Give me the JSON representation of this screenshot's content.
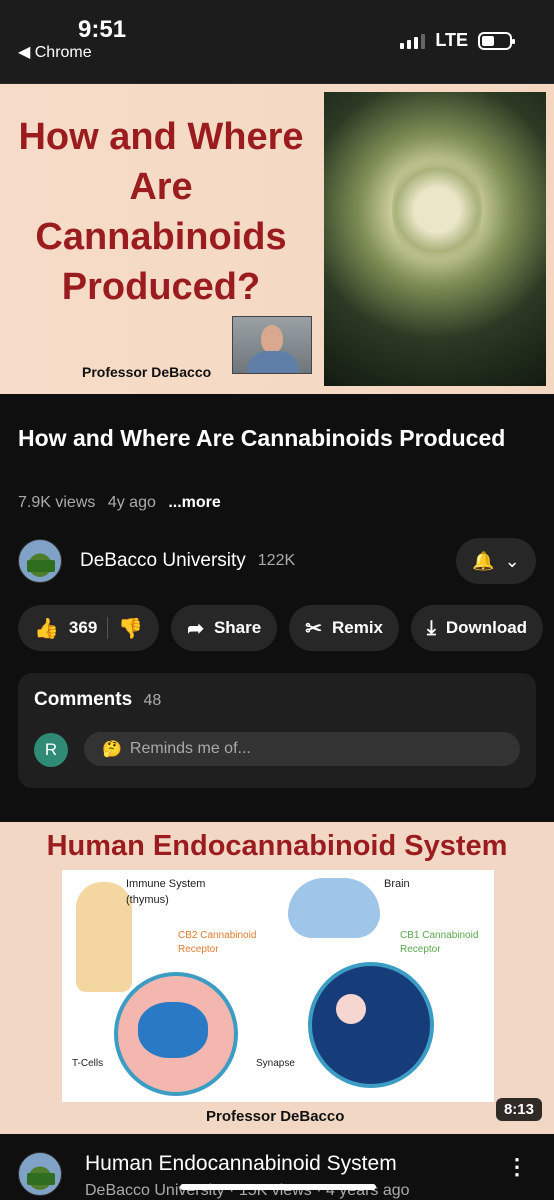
{
  "status_bar": {
    "time": "9:51",
    "back_app": "◀ Chrome",
    "network": "LTE",
    "signal_bars_on": 3,
    "signal_bars_total": 4
  },
  "hero": {
    "title": "How and Where Are Cannabinoids Produced?",
    "presenter": "Professor DeBacco"
  },
  "video": {
    "title": "How and Where Are Cannabinoids Produced",
    "views": "7.9K views",
    "age": "4y ago",
    "more": "...more"
  },
  "channel": {
    "name": "DeBacco University",
    "subscribers": "122K",
    "bell_icon": "bell-icon",
    "chevron_icon": "chevron-down-icon"
  },
  "actions": {
    "likes": "369",
    "share": "Share",
    "remix": "Remix",
    "download": "Download"
  },
  "comments": {
    "label": "Comments",
    "count": "48",
    "avatar_letter": "R",
    "placeholder": "Reminds me of..."
  },
  "next_video": {
    "thumb_title": "Human Endocannabinoid System",
    "labels": {
      "immune": "Immune System",
      "thymus": "(thymus)",
      "brain": "Brain",
      "cb2": "CB2 Cannabinoid",
      "cb2b": "Receptor",
      "cb1": "CB1 Cannabinoid",
      "cb1b": "Receptor",
      "tcells": "T-Cells",
      "synapse": "Synapse"
    },
    "presenter": "Professor DeBacco",
    "duration": "8:13",
    "title": "Human Endocannabinoid System",
    "subtitle": "DeBacco University · 15K views · 4 years ago"
  },
  "colors": {
    "accent_red": "#9b1c1f",
    "background": "#0f0f0f",
    "pill": "#272727"
  }
}
